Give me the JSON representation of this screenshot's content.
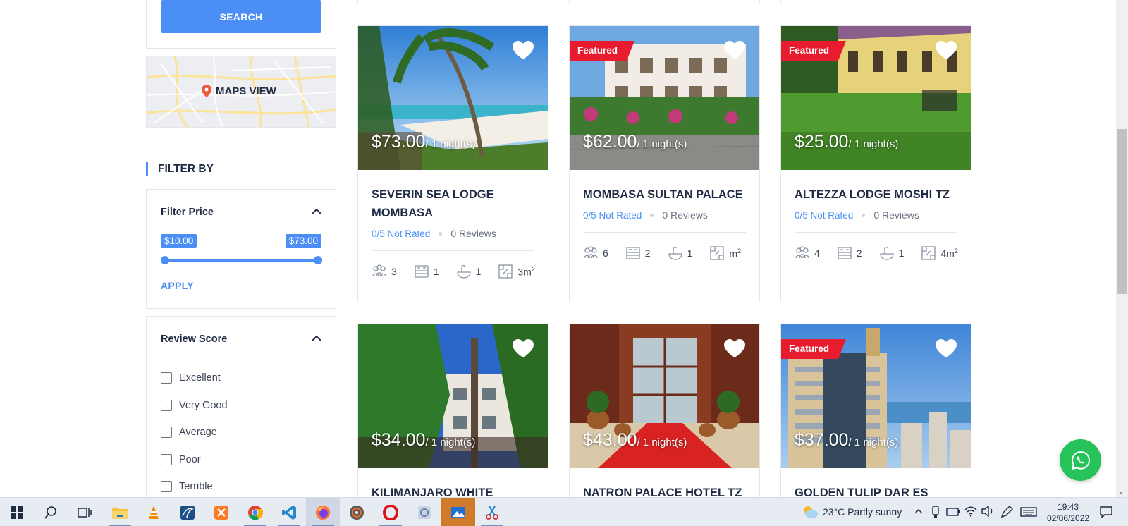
{
  "sidebar": {
    "search_label": "SEARCH",
    "maps_label": "MAPS VIEW",
    "filter_by": "FILTER BY",
    "price_panel": {
      "title": "Filter Price",
      "min": "$10.00",
      "max": "$73.00",
      "apply": "APPLY"
    },
    "review_panel": {
      "title": "Review Score",
      "options": [
        "Excellent",
        "Very Good",
        "Average",
        "Poor",
        "Terrible"
      ]
    }
  },
  "cards": [
    {
      "title": "SEVERIN SEA LODGE MOMBASA",
      "price": "$73.00",
      "per": "/ 1 night(s)",
      "featured": false,
      "rating": "0/5 Not Rated",
      "reviews": "0 Reviews",
      "amenities": {
        "guests": "3",
        "beds": "1",
        "baths": "1",
        "area": "3m"
      }
    },
    {
      "title": "MOMBASA SULTAN PALACE",
      "price": "$62.00",
      "per": "/ 1 night(s)",
      "featured": true,
      "featured_label": "Featured",
      "rating": "0/5 Not Rated",
      "reviews": "0 Reviews",
      "amenities": {
        "guests": "6",
        "beds": "2",
        "baths": "1",
        "area": "m"
      }
    },
    {
      "title": "ALTEZZA LODGE MOSHI TZ",
      "price": "$25.00",
      "per": "/ 1 night(s)",
      "featured": true,
      "featured_label": "Featured",
      "rating": "0/5 Not Rated",
      "reviews": "0 Reviews",
      "amenities": {
        "guests": "4",
        "beds": "2",
        "baths": "1",
        "area": "4m"
      }
    },
    {
      "title": "KILIMANJARO WHITE HOUSE",
      "price": "$34.00",
      "per": "/ 1 night(s)",
      "featured": false
    },
    {
      "title": "NATRON PALACE HOTEL TZ",
      "price": "$43.00",
      "per": "/ 1 night(s)",
      "featured": false
    },
    {
      "title": "GOLDEN TULIP DAR ES",
      "price": "$37.00",
      "per": "/ 1 night(s)",
      "featured": true,
      "featured_label": "Featured"
    }
  ],
  "area_sup": "2",
  "taskbar": {
    "weather": "23°C  Partly sunny",
    "time": "19:43",
    "date": "02/06/2022",
    "apps": [
      "start-icon",
      "search-icon",
      "task-view-icon",
      "file-explorer-icon",
      "vlc-icon",
      "app-icon",
      "xampp-icon",
      "chrome-icon",
      "vscode-icon",
      "firefox-icon",
      "media-icon",
      "opera-icon",
      "app2-icon",
      "photos-icon",
      "snipping-icon"
    ]
  },
  "colors": {
    "accent": "#4b8ef5",
    "featured": "#e81c2e",
    "whatsapp": "#25c35a"
  }
}
